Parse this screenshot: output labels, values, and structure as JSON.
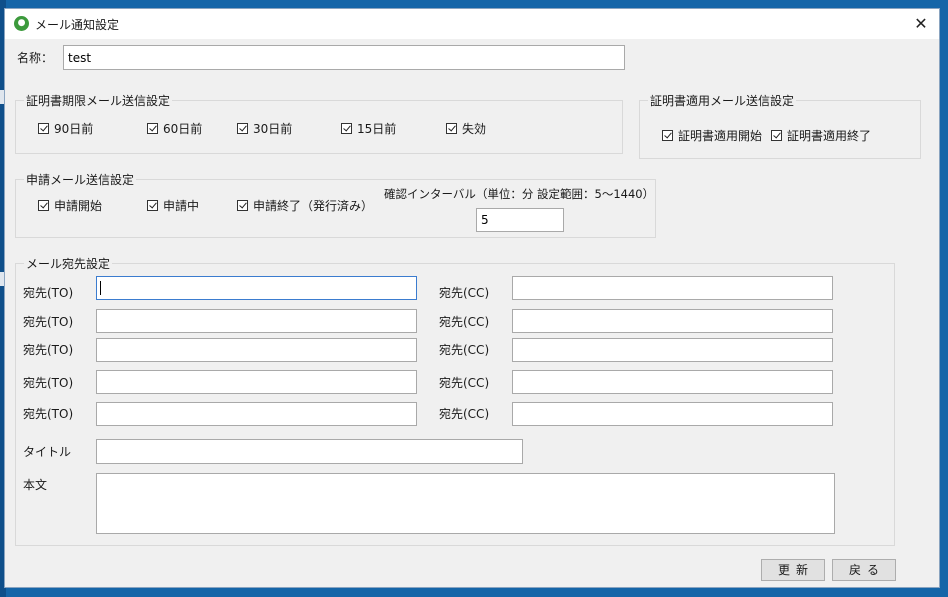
{
  "window": {
    "title": "メール通知設定"
  },
  "name": {
    "label": "名称：",
    "value": "test"
  },
  "cert_expiry": {
    "title": "証明書期限メール送信設定",
    "items": [
      {
        "label": "90日前",
        "checked": true
      },
      {
        "label": "60日前",
        "checked": true
      },
      {
        "label": "30日前",
        "checked": true
      },
      {
        "label": "15日前",
        "checked": true
      },
      {
        "label": "失効",
        "checked": true
      }
    ]
  },
  "cert_apply": {
    "title": "証明書適用メール送信設定",
    "items": [
      {
        "label": "証明書適用開始",
        "checked": true
      },
      {
        "label": "証明書適用終了",
        "checked": true
      }
    ]
  },
  "apply_mail": {
    "title": "申請メール送信設定",
    "items": [
      {
        "label": "申請開始",
        "checked": true
      },
      {
        "label": "申請中",
        "checked": true
      },
      {
        "label": "申請終了（発行済み）",
        "checked": true
      }
    ],
    "interval_label": "確認インターバル（単位：分 設定範囲：5〜1440）",
    "interval_value": "5"
  },
  "recipients": {
    "title": "メール宛先設定",
    "to_label": "宛先(TO)",
    "cc_label": "宛先(CC)",
    "title_label": "タイトル",
    "body_label": "本文"
  },
  "buttons": {
    "update": "更新",
    "back": "戻る"
  }
}
